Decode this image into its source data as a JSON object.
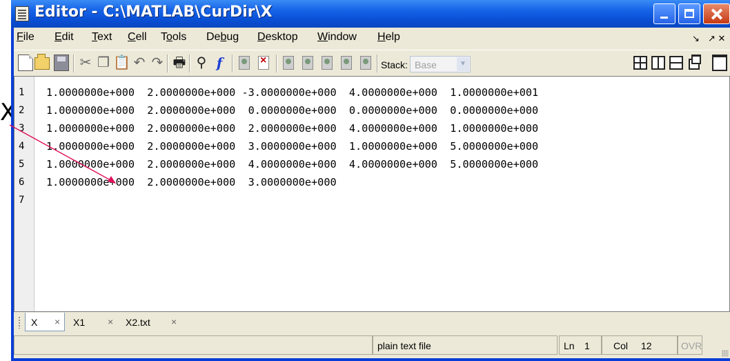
{
  "annotation": {
    "label": "X"
  },
  "window": {
    "title": "Editor - C:\\MATLAB\\CurDir\\X"
  },
  "menu": {
    "items": [
      {
        "label": "File",
        "underline": "F"
      },
      {
        "label": "Edit",
        "underline": "E"
      },
      {
        "label": "Text",
        "underline": "T"
      },
      {
        "label": "Cell",
        "underline": "C"
      },
      {
        "label": "Tools",
        "underline": "o"
      },
      {
        "label": "Debug",
        "underline": "b"
      },
      {
        "label": "Desktop",
        "underline": "D"
      },
      {
        "label": "Window",
        "underline": "W"
      },
      {
        "label": "Help",
        "underline": "H"
      }
    ],
    "dock_icons": [
      "↘",
      "↗ ✕"
    ]
  },
  "toolbar": {
    "stack_label": "Stack:",
    "stack_value": "Base",
    "icons": [
      "new-file-icon",
      "open-folder-icon",
      "save-icon",
      "cut-icon",
      "copy-icon",
      "paste-icon",
      "undo-icon",
      "redo-icon",
      "print-icon",
      "find-icon",
      "function-icon",
      "set-breakpoint-icon",
      "clear-breakpoint-icon",
      "step-icon",
      "step-in-icon",
      "step-out-icon",
      "continue-icon",
      "exit-debug-icon",
      "tile-icon",
      "columns-icon",
      "rows-icon",
      "float-icon",
      "maximize-icon"
    ]
  },
  "editor": {
    "line_numbers": [
      "1",
      "2",
      "3",
      "4",
      "5",
      "6",
      "7"
    ],
    "lines": [
      "1.0000000e+000  2.0000000e+000 -3.0000000e+000  4.0000000e+000  1.0000000e+001",
      "1.0000000e+000  2.0000000e+000  0.0000000e+000  0.0000000e+000  0.0000000e+000",
      "1.0000000e+000  2.0000000e+000  2.0000000e+000  4.0000000e+000  1.0000000e+000",
      "1.0000000e+000  2.0000000e+000  3.0000000e+000  1.0000000e+000  5.0000000e+000",
      "1.0000000e+000  2.0000000e+000  4.0000000e+000  4.0000000e+000  5.0000000e+000",
      "1.0000000e+000  2.0000000e+000  3.0000000e+000",
      ""
    ]
  },
  "tabs": [
    {
      "label": "X",
      "close": "×",
      "active": true
    },
    {
      "label": "X1",
      "close": "×",
      "active": false
    },
    {
      "label": "X2.txt",
      "close": "×",
      "active": false
    }
  ],
  "status": {
    "file_type": "plain text file",
    "ln_label": "Ln",
    "ln_value": "1",
    "col_label": "Col",
    "col_value": "12",
    "ovr": "OVR"
  },
  "colors": {
    "titlebar": "#0a50d6",
    "chrome": "#ece9d8",
    "close_button": "#c53a14",
    "arrow": "#e0105a"
  }
}
